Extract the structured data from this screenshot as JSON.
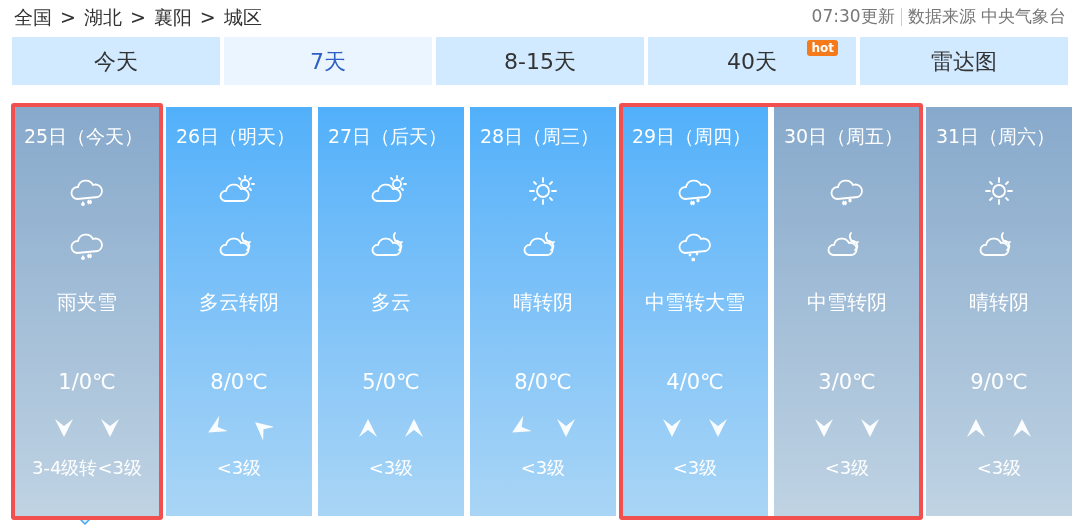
{
  "breadcrumb": [
    "全国",
    ">",
    "湖北",
    ">",
    "襄阳",
    ">",
    "城区"
  ],
  "update": {
    "time": "07:30更新",
    "source": "数据来源 中央气象台"
  },
  "tabs": [
    {
      "label": "今天",
      "selected": false
    },
    {
      "label": "7天",
      "selected": true
    },
    {
      "label": "8-15天",
      "selected": false
    },
    {
      "label": "40天",
      "selected": false,
      "badge": "hot"
    },
    {
      "label": "雷达图",
      "selected": false
    }
  ],
  "days": [
    {
      "date": "25日（今天）",
      "dimmed": true,
      "outlined": true,
      "selected": true,
      "icons": [
        {
          "kind": "sleet"
        },
        {
          "kind": "sleet"
        }
      ],
      "weather": "雨夹雪",
      "temp": "1/0℃",
      "winds": [
        {
          "kind": "down"
        },
        {
          "kind": "down"
        }
      ],
      "wind": "3-4级转<3级"
    },
    {
      "date": "26日（明天）",
      "dimmed": false,
      "outlined": false,
      "selected": false,
      "icons": [
        {
          "kind": "sun-cloud"
        },
        {
          "kind": "moon-cloud"
        }
      ],
      "weather": "多云转阴",
      "temp": "8/0℃",
      "winds": [
        {
          "kind": "lowerleft"
        },
        {
          "kind": "upperleft"
        }
      ],
      "wind": "<3级"
    },
    {
      "date": "27日（后天）",
      "dimmed": false,
      "outlined": false,
      "selected": false,
      "icons": [
        {
          "kind": "sun-cloud"
        },
        {
          "kind": "moon-cloud"
        }
      ],
      "weather": "多云",
      "temp": "5/0℃",
      "winds": [
        {
          "kind": "up"
        },
        {
          "kind": "up"
        }
      ],
      "wind": "<3级"
    },
    {
      "date": "28日（周三）",
      "dimmed": false,
      "outlined": false,
      "selected": false,
      "icons": [
        {
          "kind": "sun"
        },
        {
          "kind": "moon-cloud"
        }
      ],
      "weather": "晴转阴",
      "temp": "8/0℃",
      "winds": [
        {
          "kind": "lowerleft"
        },
        {
          "kind": "down"
        }
      ],
      "wind": "<3级"
    },
    {
      "date": "29日（周四）",
      "dimmed": false,
      "outlined": true,
      "selected": false,
      "icons": [
        {
          "kind": "snow"
        },
        {
          "kind": "heavysnow"
        }
      ],
      "weather": "中雪转大雪",
      "temp": "4/0℃",
      "winds": [
        {
          "kind": "down"
        },
        {
          "kind": "down"
        }
      ],
      "wind": "<3级"
    },
    {
      "date": "30日（周五）",
      "dimmed": true,
      "outlined": true,
      "selected": false,
      "icons": [
        {
          "kind": "snow"
        },
        {
          "kind": "moon-cloud"
        }
      ],
      "weather": "中雪转阴",
      "temp": "3/0℃",
      "winds": [
        {
          "kind": "down"
        },
        {
          "kind": "down"
        }
      ],
      "wind": "<3级"
    },
    {
      "date": "31日（周六）",
      "dimmed": true,
      "outlined": false,
      "selected": false,
      "icons": [
        {
          "kind": "sun"
        },
        {
          "kind": "moon-cloud"
        }
      ],
      "weather": "晴转阴",
      "temp": "9/0℃",
      "winds": [
        {
          "kind": "up"
        },
        {
          "kind": "up"
        }
      ],
      "wind": "<3级"
    }
  ]
}
